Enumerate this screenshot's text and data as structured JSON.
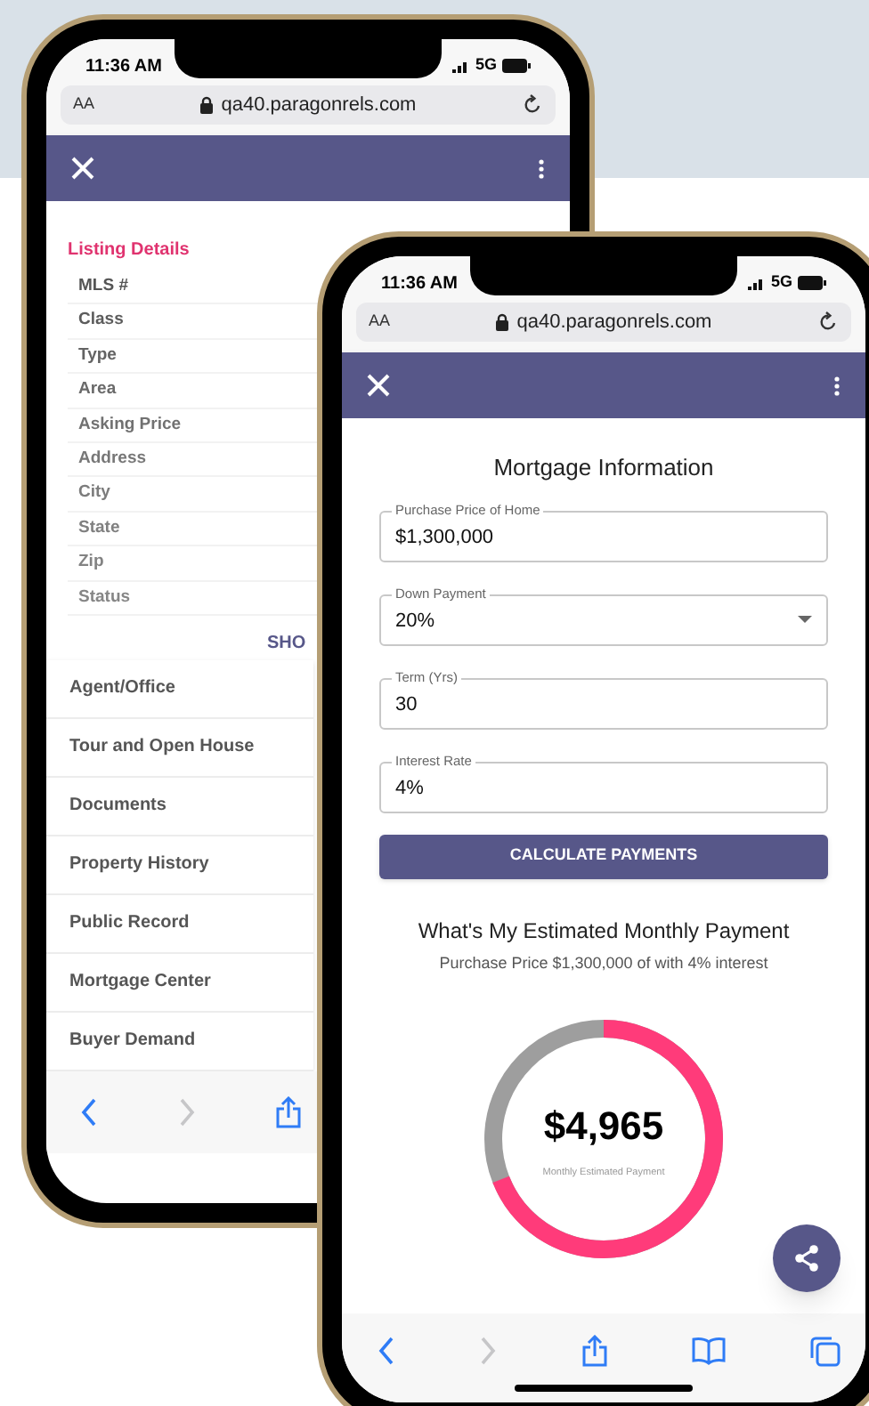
{
  "back_phone": {
    "status_bar": {
      "time": "11:36 AM",
      "network": "5G"
    },
    "browser_bar": {
      "text_size": "AA",
      "url": "qa40.paragonrels.com"
    },
    "listing_details": {
      "title": "Listing Details",
      "fields": [
        "MLS #",
        "Class",
        "Type",
        "Area",
        "Asking Price",
        "Address",
        "City",
        "State",
        "Zip",
        "Status"
      ],
      "show_more": "SHO"
    },
    "sections": [
      "Agent/Office",
      "Tour and Open House",
      "Documents",
      "Property History",
      "Public Record",
      "Mortgage Center",
      "Buyer Demand"
    ]
  },
  "front_phone": {
    "status_bar": {
      "time": "11:36 AM",
      "network": "5G"
    },
    "browser_bar": {
      "text_size": "AA",
      "url": "qa40.paragonrels.com"
    },
    "title": "Mortgage Information",
    "fields": [
      {
        "kind": "text",
        "label": "Purchase Price of Home",
        "value": "$1,300,000"
      },
      {
        "kind": "select",
        "label": "Down Payment",
        "value": "20%"
      },
      {
        "kind": "text",
        "label": "Term (Yrs)",
        "value": "30"
      },
      {
        "kind": "text",
        "label": "Interest Rate",
        "value": "4%"
      }
    ],
    "calculate_button": "CALCULATE PAYMENTS",
    "result": {
      "heading": "What's My Estimated Monthly Payment",
      "subtitle": "Purchase Price $1,300,000 of with 4% interest",
      "amount": "$4,965",
      "caption": "Monthly Estimated Payment"
    }
  }
}
